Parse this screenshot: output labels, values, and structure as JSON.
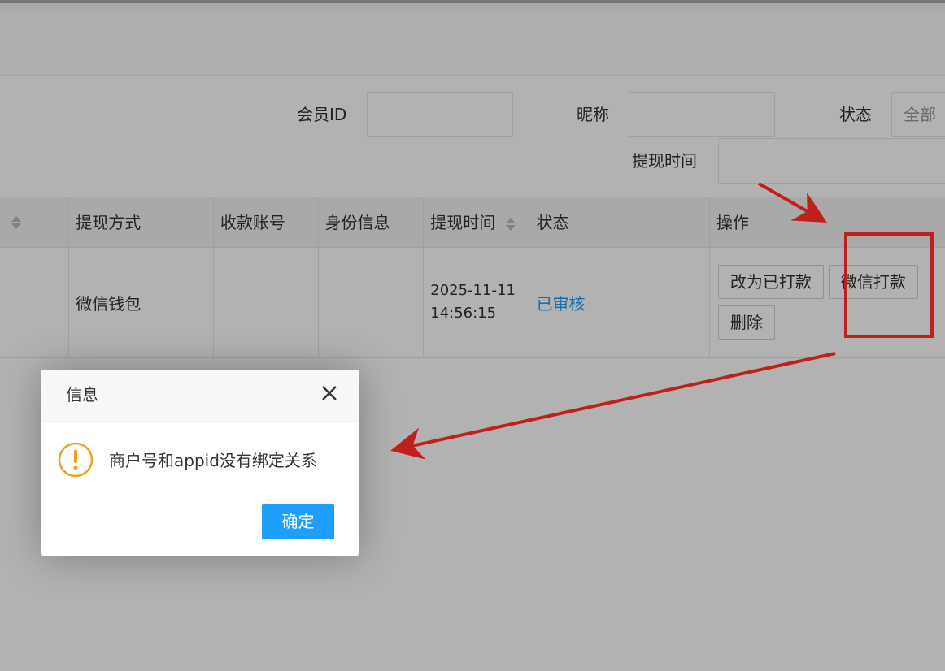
{
  "filters": {
    "member_id_label": "会员ID",
    "nickname_label": "昵称",
    "status_label": "状态",
    "status_value": "全部",
    "withdraw_time_label": "提现时间"
  },
  "table": {
    "headers": [
      "提现方式",
      "收款账号",
      "身份信息",
      "提现时间",
      "状态",
      "操作"
    ],
    "row": {
      "method": "微信钱包",
      "account": "",
      "identity": "",
      "time_date": "2025-11-11",
      "time_clock": "14:56:15",
      "status": "已审核",
      "actions": [
        "改为已打款",
        "微信打款",
        "删除"
      ]
    }
  },
  "dialog": {
    "title": "信息",
    "message": "商户号和appid没有绑定关系",
    "ok_label": "确定",
    "icon": "warning-icon"
  },
  "colors": {
    "accent": "#1e9fff",
    "warning": "#f0a020",
    "annotation": "#c0201a"
  }
}
